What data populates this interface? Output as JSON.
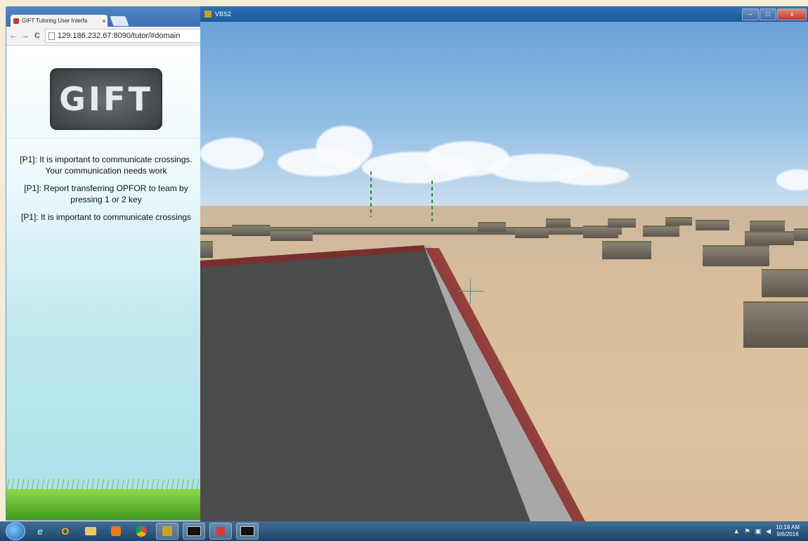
{
  "browser": {
    "tab_title": "GIFT Tutoring User Interfa",
    "tab_close": "×",
    "address": "129.186.232.67:8090/tutor/#domain",
    "nav": {
      "back": "←",
      "forward": "→",
      "reload": "C"
    }
  },
  "tutor": {
    "logo_text": "GIFT",
    "messages": [
      "[P1]: It is important to communicate crossings. Your communication needs work",
      "[P1]: Report transferring OPFOR to team by pressing 1 or 2 key",
      "[P1]: It is important to communicate crossings"
    ]
  },
  "game_window": {
    "title": "VBS2",
    "controls": {
      "minimize": "–",
      "maximize": "□",
      "close": "x"
    }
  },
  "taskbar": {
    "icons": [
      "start-orb",
      "internet-explorer",
      "opera",
      "file-explorer",
      "media-player",
      "chrome",
      "vbs2",
      "console",
      "gift",
      "console"
    ],
    "tray": {
      "time": "10:18 AM",
      "date": "9/6/2016"
    }
  }
}
